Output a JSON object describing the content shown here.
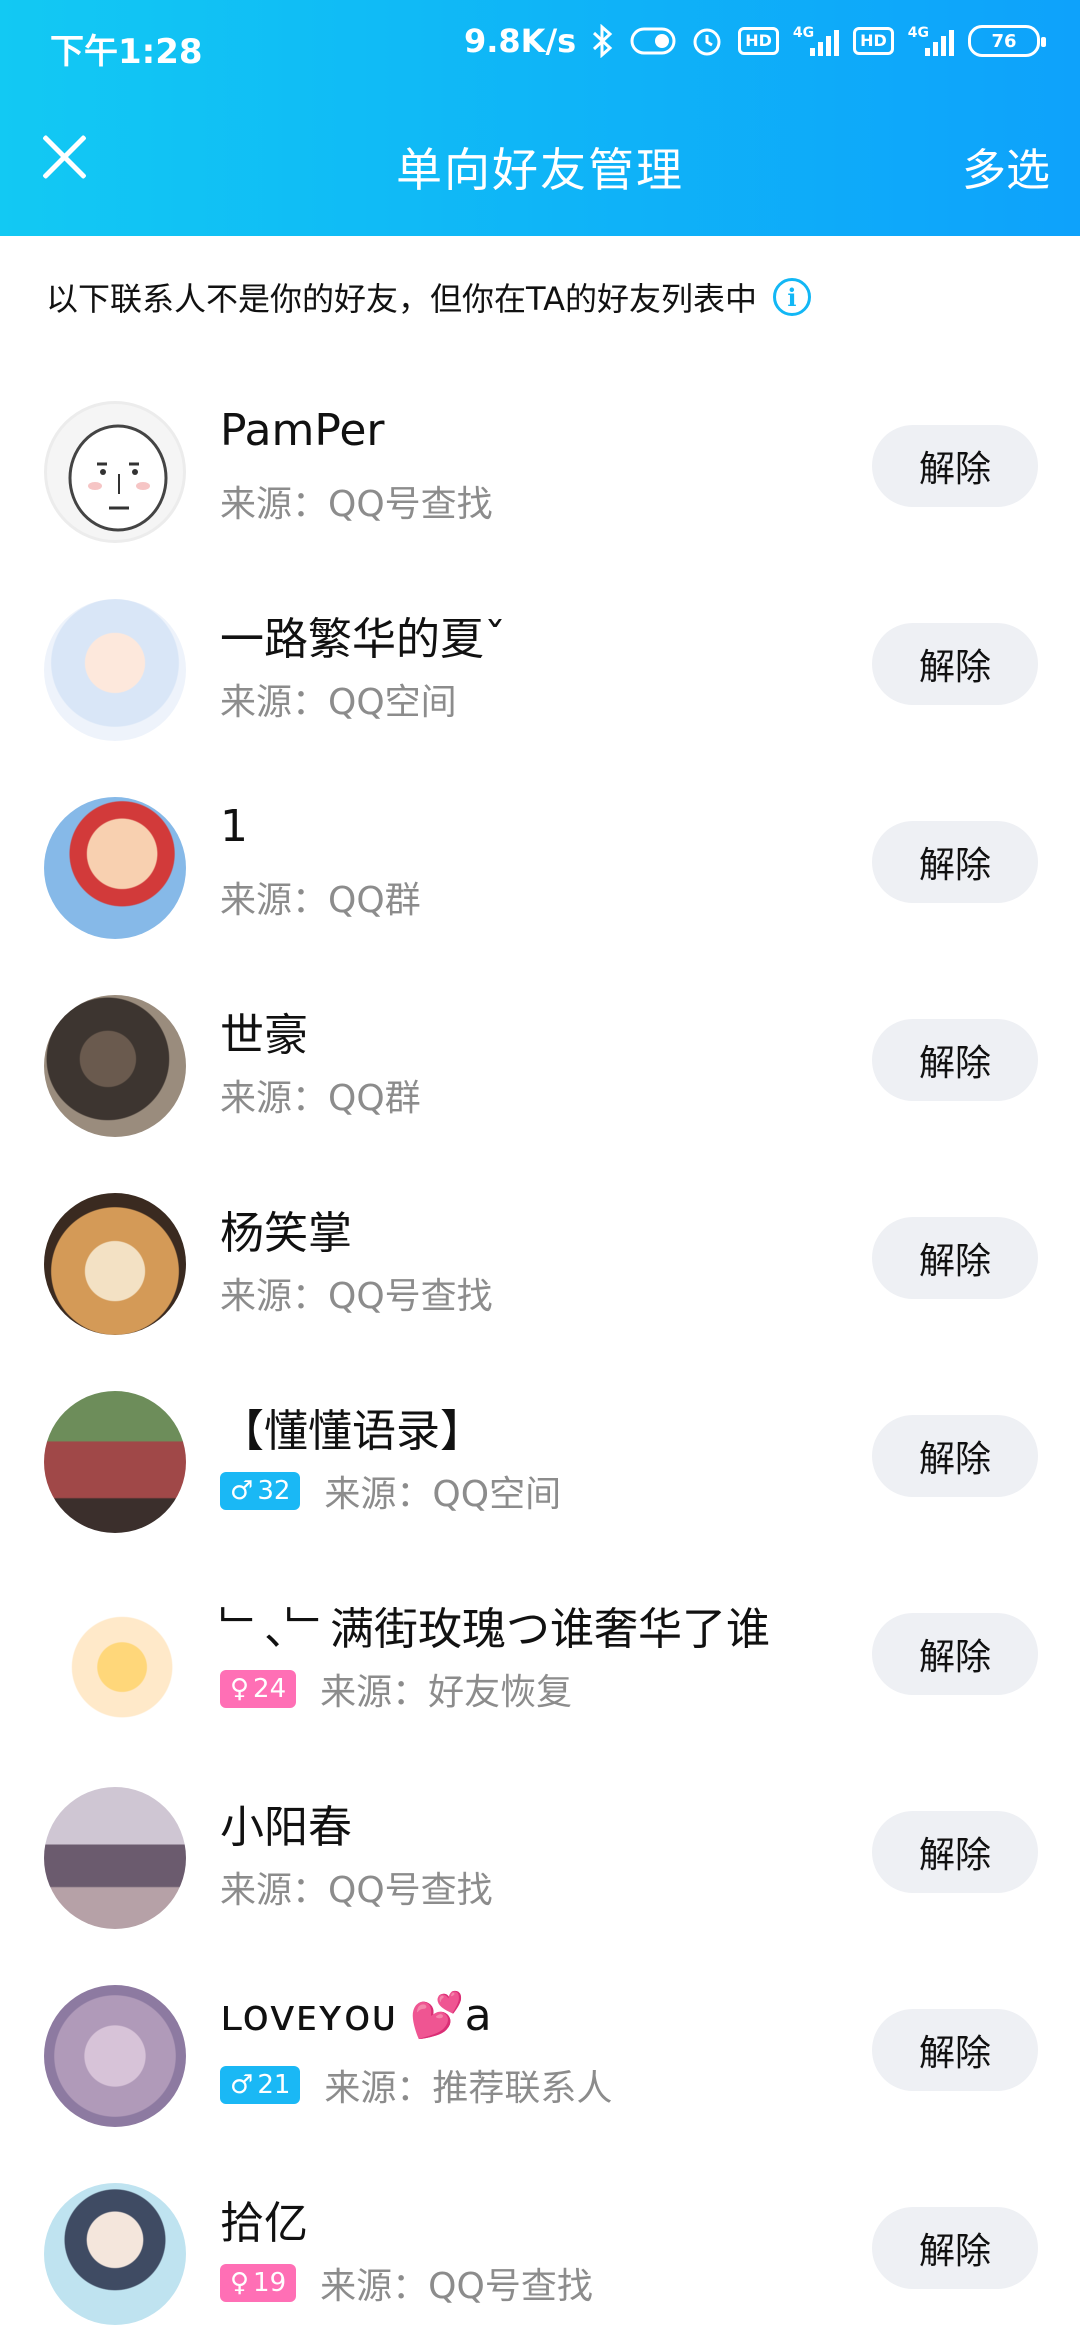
{
  "status_bar": {
    "time": "下午1:28",
    "speed": "9.8K/s",
    "battery": "76",
    "hd1": "HD",
    "hd2": "HD",
    "net1": "4G",
    "net2": "4G"
  },
  "nav": {
    "title": "单向好友管理",
    "action": "多选"
  },
  "notice": {
    "text": "以下联系人不是你的好友，但你在TA的好友列表中",
    "info_glyph": "i"
  },
  "remove_label": "解除",
  "contacts": [
    {
      "name": "PamPer",
      "source": "来源：QQ号查找"
    },
    {
      "name": "一路繁华的夏ˇ",
      "source": "来源：QQ空间"
    },
    {
      "name": "1",
      "source": "来源：QQ群"
    },
    {
      "name": "世豪",
      "source": "来源：QQ群"
    },
    {
      "name": "杨笑掌",
      "source": "来源：QQ号查找"
    },
    {
      "name": "【懂懂语录】",
      "source": "来源：QQ空间",
      "gender": "♂",
      "age": "32"
    },
    {
      "name": "﹂、﹂满街玫瑰つ谁奢华了谁",
      "source": "来源：好友恢复",
      "gender": "♀",
      "age": "24"
    },
    {
      "name": "小阳春",
      "source": "来源：QQ号查找"
    },
    {
      "name": "ʟᴏᴠᴇʏᴏᴜ 💕a",
      "source": "来源：推荐联系人",
      "gender": "♂",
      "age": "21"
    },
    {
      "name": "拾亿",
      "source": "来源：QQ号查找",
      "gender": "♀",
      "age": "19"
    }
  ]
}
